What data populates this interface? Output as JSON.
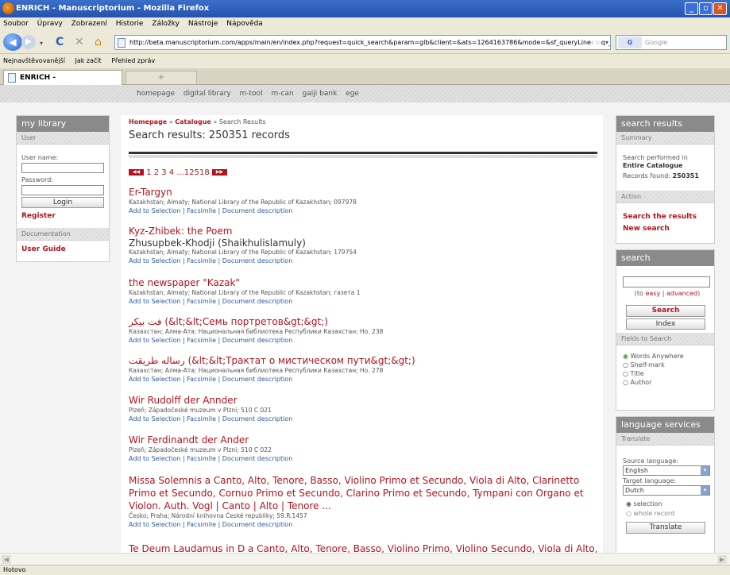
{
  "window": {
    "title": "ENRICH - Manuscriptorium - Mozilla Firefox"
  },
  "menu": [
    "Soubor",
    "Úpravy",
    "Zobrazení",
    "Historie",
    "Záložky",
    "Nástroje",
    "Nápověda"
  ],
  "address": {
    "url": "http://beta.manuscriptorium.com/apps/main/en/index.php?request=quick_search&param=glb&client=&ats=1264163786&mode=&sf_queryLine=&qs_field="
  },
  "search_engine": {
    "placeholder": "Google",
    "logo": "G"
  },
  "bookmarks": [
    "Nejnavštěvovanější",
    "Jak začít",
    "Přehled zpráv"
  ],
  "tab": {
    "label": "ENRICH - Manuscriptorium",
    "new_tab": "+"
  },
  "topnav": [
    "homepage",
    "digital library",
    "m-tool",
    "m-can",
    "gaiji bank",
    "ege"
  ],
  "library": {
    "title": "my library",
    "user_section": "User",
    "username_label": "User name:",
    "password_label": "Password:",
    "login": "Login",
    "register": "Register",
    "doc_section": "Documentation",
    "guide": "User Guide"
  },
  "main": {
    "breadcrumb_home": "Homepage",
    "breadcrumb_sep1": "»",
    "breadcrumb_catalogue": "Catalogue",
    "breadcrumb_sep2": "»",
    "breadcrumb_current": "Search Results",
    "heading": "Search results: 250351 records",
    "pager": {
      "prev": "◀◀",
      "pages": "1 2 3 4 ...12518",
      "next": "▶▶"
    },
    "link_add": "Add to Selection",
    "link_sep": "|",
    "link_facsimile": "Facsimile",
    "link_desc": "Document description",
    "records": [
      {
        "title": "Er-Targyn",
        "subtitle": "",
        "meta": "Kazakhstan; Almaty; National Library of the Republic of Kazakhstan; 097978"
      },
      {
        "title": "Kyz-Zhibek: the Poem",
        "subtitle": "Zhusupbek-Khodji (Shaikhulislamuly)",
        "meta": "Kazakhstan; Almaty; National Library of the Republic of Kazakhstan; 179754"
      },
      {
        "title": "the newspaper \"Kazak\"",
        "subtitle": "",
        "meta": "Kazakhstan; Almaty; National Library of the Republic of Kazakhstan; газета 1"
      },
      {
        "title": "فت بیکر (&lt;&lt;Семь портретов&gt;&gt;)",
        "subtitle": "",
        "meta": "Казахстан; Алма-Ата; Национальная библиотека Республики Казахстан; Но. 238"
      },
      {
        "title": "رساله طریقت (&lt;&lt;Трактат о мистическом пути&gt;&gt;)",
        "subtitle": "",
        "meta": "Казахстан; Алма-Ата; Национальная библиотека Республики Казахстан; Но. 278"
      },
      {
        "title": "Wir Rudolff der Annder",
        "subtitle": "",
        "meta": "Plzeň; Západočeské muzeum v Plzni; 510 C 021"
      },
      {
        "title": "Wir Ferdinandt der Ander",
        "subtitle": "",
        "meta": "Plzeň; Západočeské muzeum v Plzni; 510 C 022"
      },
      {
        "title": "Missa Solemnis a Canto, Alto, Tenore, Basso, Violino Primo et Secundo, Viola di Alto, Clarinetto Primo et Secundo, Cornuo Primo et Secundo, Clarino Primo et Secundo, Tympani con Organo et Violon. Auth. Vogl | Canto | Alto | Tenore ...",
        "subtitle": "",
        "meta": "Česko; Praha; Národní knihovna České republiky; 59.R.1457"
      },
      {
        "title": "Te Deum Laudamus in D a Canto, Alto, Tenore, Basso, Violino Primo, Violino Secundo, Viola di Alto,",
        "subtitle": "",
        "meta": ""
      }
    ]
  },
  "results_panel": {
    "title": "search results",
    "summary": "Summary",
    "performed": "Search performed in",
    "scope": "Entire Catalogue",
    "found_label": "Records found:",
    "found_value": "250351",
    "action": "Action",
    "search_results": "Search the results",
    "new_search": "New search"
  },
  "search_panel": {
    "title": "search",
    "to": "(to",
    "easy": "easy",
    "sep": "|",
    "advanced": "advanced",
    "close_paren": ")",
    "search_btn": "Search",
    "index_btn": "Index",
    "fields_title": "Fields to Search",
    "fields": [
      "Words Anywhere",
      "Shelf-mark",
      "Title",
      "Author"
    ],
    "selected": "Words Anywhere"
  },
  "language_panel": {
    "title": "language services",
    "translate_head": "Translate",
    "source_label": "Source language:",
    "source_value": "English",
    "target_label": "Target language:",
    "target_value": "Dutch",
    "opt_selection": "selection",
    "opt_whole": "whole record",
    "translate_btn": "Translate"
  },
  "status": "Hotovo",
  "colors": {
    "accent": "#b0141e",
    "link": "#2a5aa0",
    "panel_head": "#8a8a8a"
  }
}
